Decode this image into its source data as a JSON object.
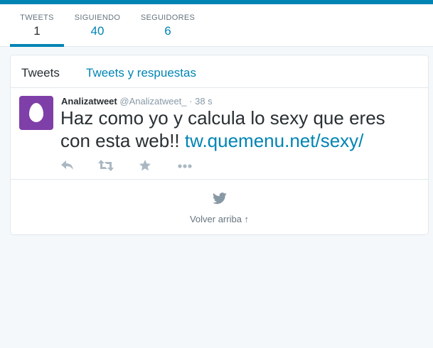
{
  "profile_nav": {
    "stats": [
      {
        "label": "TWEETS",
        "value": "1"
      },
      {
        "label": "SIGUIENDO",
        "value": "40"
      },
      {
        "label": "SEGUIDORES",
        "value": "6"
      }
    ]
  },
  "timeline": {
    "tabs": [
      {
        "label": "Tweets"
      },
      {
        "label": "Tweets y respuestas"
      }
    ],
    "tweet": {
      "fullname": "Analizatweet",
      "username": "@Analizatweet_",
      "separator": "·",
      "time": "38 s",
      "text": "Haz como yo y calcula lo sexy que eres con esta web!! ",
      "link": "tw.quemenu.net/sexy/",
      "avatar_color": "#7f3fa8"
    },
    "back_to_top": "Volver arriba ↑"
  },
  "colors": {
    "accent": "#0084b4",
    "icon_gray": "#aab8c2",
    "background": "#f5f8fa"
  },
  "icons": [
    "reply-icon",
    "retweet-icon",
    "favorite-icon",
    "more-icon",
    "bird-icon",
    "egg-avatar-icon"
  ]
}
